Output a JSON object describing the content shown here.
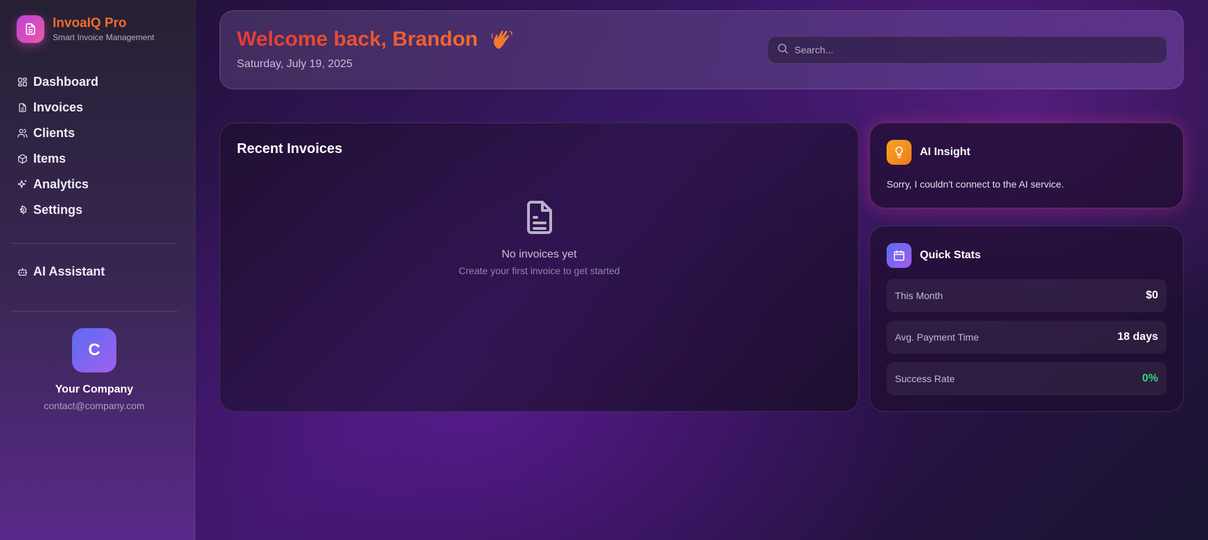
{
  "brand": {
    "name": "InvoaIQ Pro",
    "subtitle": "Smart Invoice Management",
    "logo_icon": "document-icon"
  },
  "nav": {
    "items": [
      {
        "label": "Dashboard",
        "icon": "grid-icon"
      },
      {
        "label": "Invoices",
        "icon": "document-icon"
      },
      {
        "label": "Clients",
        "icon": "users-icon"
      },
      {
        "label": "Items",
        "icon": "box-icon"
      },
      {
        "label": "Analytics",
        "icon": "sparkles-icon"
      },
      {
        "label": "Settings",
        "icon": "gear-icon"
      }
    ],
    "assistant": {
      "label": "AI Assistant",
      "icon": "bot-icon"
    }
  },
  "company": {
    "initial": "C",
    "name": "Your Company",
    "email": "contact@company.com"
  },
  "header": {
    "welcome": "Welcome back, Brandon",
    "wave_icon": "waving-hand-icon",
    "date": "Saturday, July 19, 2025",
    "search_placeholder": "Search..."
  },
  "recent_invoices": {
    "title": "Recent Invoices",
    "empty_title": "No invoices yet",
    "empty_subtitle": "Create your first invoice to get started"
  },
  "ai_insight": {
    "title": "AI Insight",
    "message": "Sorry, I couldn't connect to the AI service.",
    "icon": "lightbulb-icon"
  },
  "quick_stats": {
    "title": "Quick Stats",
    "icon": "calendar-icon",
    "rows": [
      {
        "label": "This Month",
        "value": "$0",
        "color": "#ffffff"
      },
      {
        "label": "Avg. Payment Time",
        "value": "18 days",
        "color": "#ffffff"
      },
      {
        "label": "Success Rate",
        "value": "0%",
        "color": "#34d37a"
      }
    ]
  },
  "colors": {
    "brand_orange": "#f26b2e",
    "welcome_red": "#e53935",
    "success_green": "#34d37a"
  }
}
